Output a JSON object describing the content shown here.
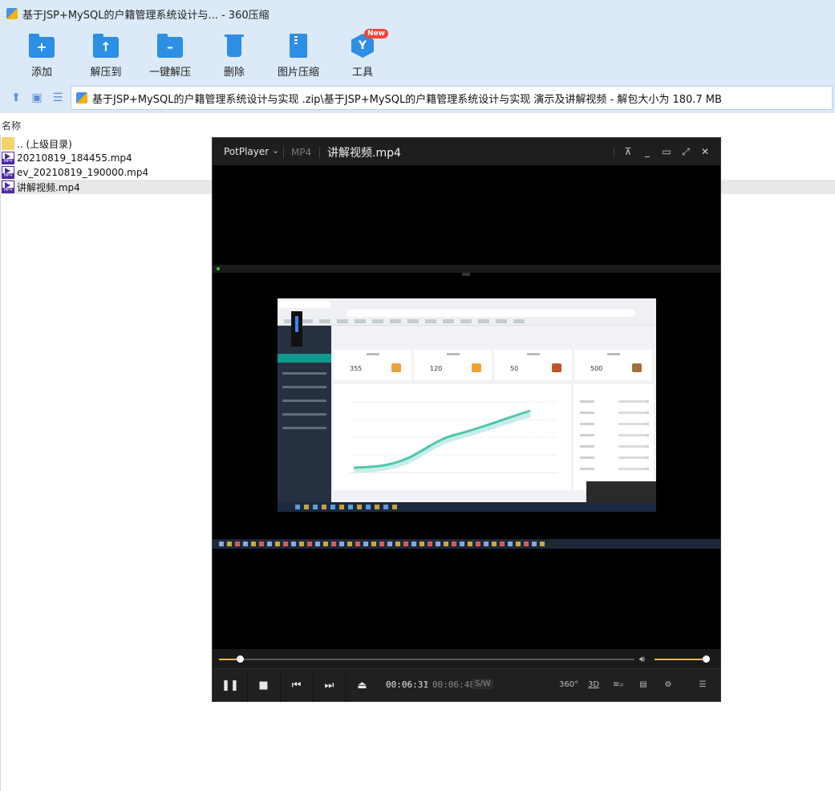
{
  "window": {
    "title": "基于JSP+MySQL的户籍管理系统设计与... - 360压缩"
  },
  "toolbar": {
    "items": [
      {
        "label": "添加",
        "icon": "add-folder-icon"
      },
      {
        "label": "解压到",
        "icon": "extract-to-icon"
      },
      {
        "label": "一键解压",
        "icon": "one-click-extract-icon"
      },
      {
        "label": "删除",
        "icon": "delete-icon"
      },
      {
        "label": "图片压缩",
        "icon": "image-compress-icon"
      },
      {
        "label": "工具",
        "icon": "tools-icon",
        "badge": "New"
      }
    ]
  },
  "address": {
    "path": "基于JSP+MySQL的户籍管理系统设计与实现 .zip\\基于JSP+MySQL的户籍管理系统设计与实现 演示及讲解视频 - 解包大小为 180.7 MB"
  },
  "list": {
    "column_name": "名称",
    "files": [
      {
        "name": ".. (上级目录)",
        "type": "folder"
      },
      {
        "name": "20210819_184455.mp4",
        "type": "mp4"
      },
      {
        "name": "ev_20210819_190000.mp4",
        "type": "mp4"
      },
      {
        "name": "讲解视频.mp4",
        "type": "mp4",
        "selected": true
      }
    ]
  },
  "player": {
    "app_name": "PotPlayer",
    "format": "MP4",
    "file_name": "讲解视频.mp4",
    "time_current": "00:06:31",
    "time_separator": "/",
    "time_total": "00:06:48",
    "sw_label": "S/W",
    "label_360": "360°",
    "label_3d": "3D",
    "seek_fraction": 0.05,
    "volume_fraction": 1.0,
    "accent_color": "#f5c400"
  },
  "video_content": {
    "stats": [
      "355",
      "120",
      "50",
      "500"
    ]
  }
}
